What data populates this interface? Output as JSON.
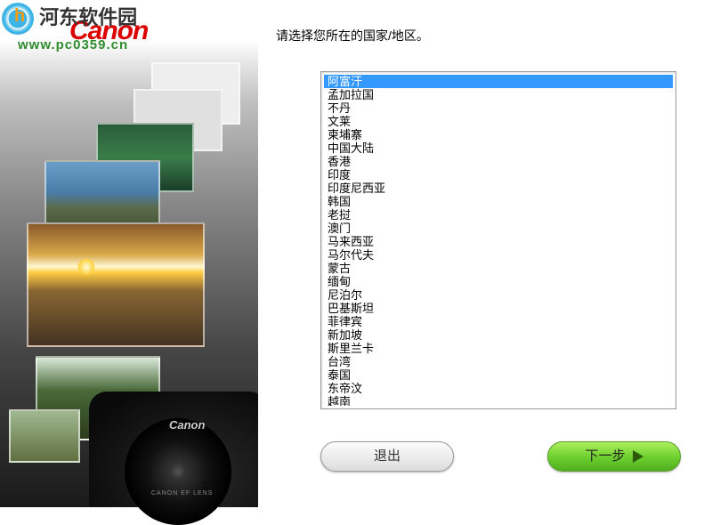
{
  "watermark": {
    "site_name": "河东软件园",
    "url": "www.pc0359.cn"
  },
  "brand": {
    "logo_text": "Canon",
    "camera_brand": "Canon",
    "lens_text": "CANON EF LENS"
  },
  "main": {
    "prompt": "请选择您所在的国家/地区。",
    "selected_index": 0,
    "countries": [
      "阿富汗",
      "孟加拉国",
      "不丹",
      "文莱",
      "柬埔寨",
      "中国大陆",
      "香港",
      "印度",
      "印度尼西亚",
      "韩国",
      "老挝",
      "澳门",
      "马来西亚",
      "马尔代夫",
      "蒙古",
      "缅甸",
      "尼泊尔",
      "巴基斯坦",
      "菲律宾",
      "新加坡",
      "斯里兰卡",
      "台湾",
      "泰国",
      "东帝汶",
      "越南"
    ]
  },
  "buttons": {
    "exit": "退出",
    "next": "下一步"
  },
  "colors": {
    "accent_green": "#6fd030",
    "selection_blue": "#3398ff",
    "canon_red": "#d00000"
  }
}
